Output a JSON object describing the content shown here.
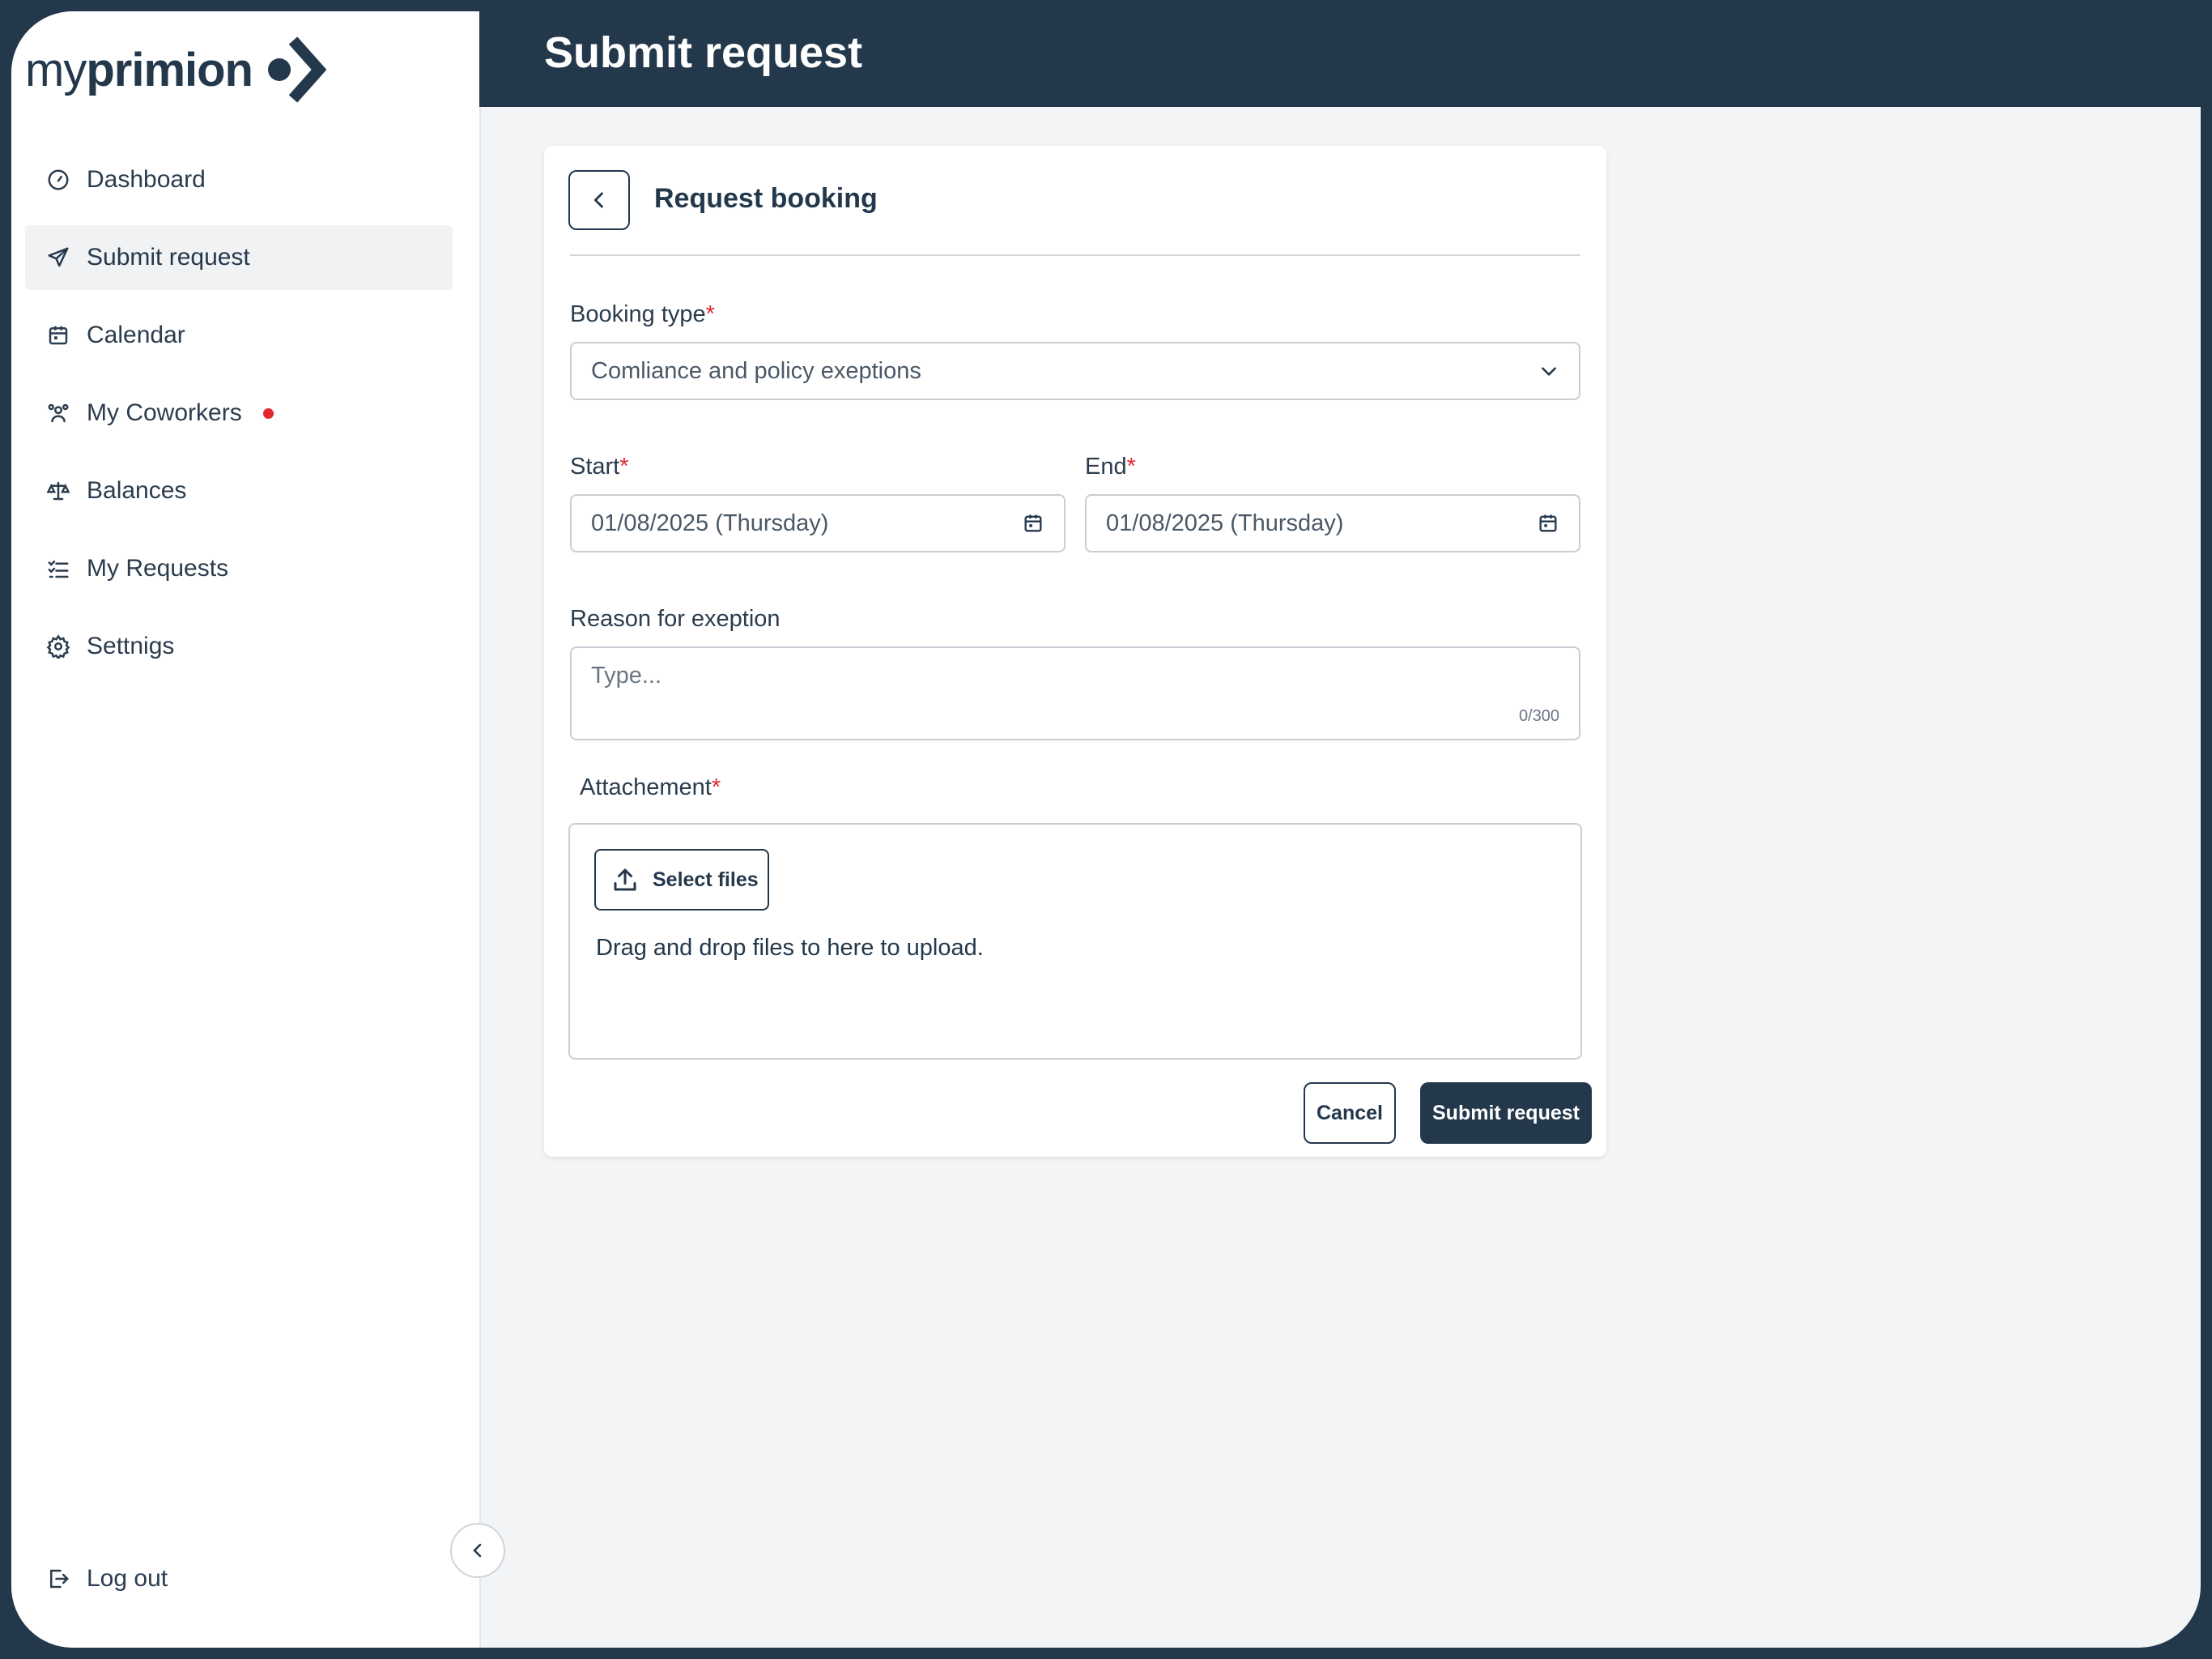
{
  "app": {
    "logo_light": "my",
    "logo_bold": "primion",
    "brand_color": "#24384c",
    "accent_red": "#e0282e"
  },
  "sidebar": {
    "items": [
      {
        "label": "Dashboard",
        "icon": "gauge-icon"
      },
      {
        "label": "Submit request",
        "icon": "paper-plane-icon",
        "active": true
      },
      {
        "label": "Calendar",
        "icon": "calendar-icon"
      },
      {
        "label": "My Coworkers",
        "icon": "users-icon",
        "badge": "notification-dot"
      },
      {
        "label": "Balances",
        "icon": "scale-icon"
      },
      {
        "label": "My Requests",
        "icon": "checklist-icon"
      },
      {
        "label": "Settnigs",
        "icon": "gear-icon"
      }
    ],
    "logout_label": "Log out"
  },
  "header": {
    "title": "Submit request"
  },
  "form": {
    "title": "Request booking",
    "booking_type": {
      "label": "Booking type",
      "value": "Comliance and policy exeptions"
    },
    "start": {
      "label": "Start",
      "value": "01/08/2025 (Thursday)"
    },
    "end": {
      "label": "End",
      "value": "01/08/2025 (Thursday)"
    },
    "reason": {
      "label": "Reason for exeption",
      "placeholder": "Type...",
      "counter": "0/300"
    },
    "attachment": {
      "label": "Attachement",
      "select_files": "Select files",
      "drop_hint": "Drag and drop files to here to upload."
    },
    "required_mark": "*",
    "cancel_label": "Cancel",
    "submit_label": "Submit request"
  }
}
